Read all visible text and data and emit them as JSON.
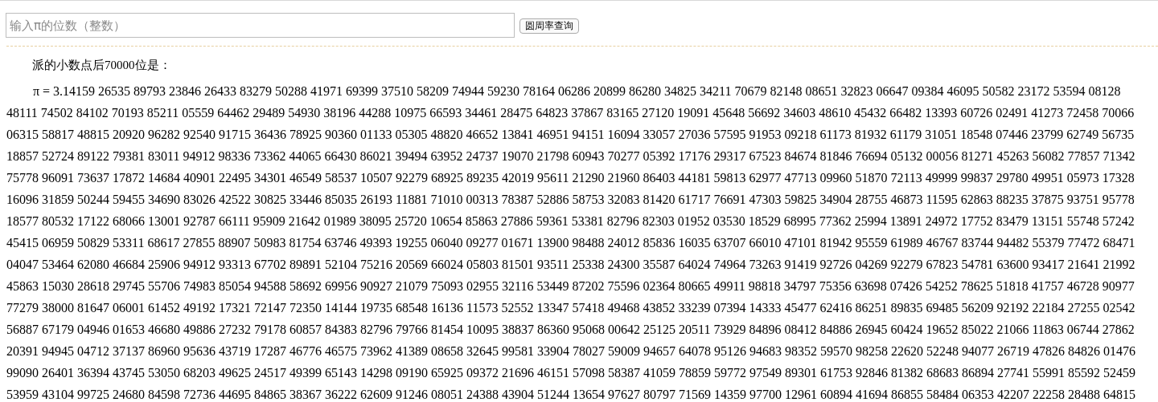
{
  "search": {
    "placeholder": "输入π的位数（整数）",
    "button": "圆周率查询"
  },
  "result": {
    "heading": "派的小数点后70000位是：",
    "lines": [
      "π = 3.14159 26535 89793 23846 26433 83279 50288 41971 69399 37510 58209 74944 59230 78164 06286 20899 86280 34825 34211 70679 82148 08651 32823 06647 09384 46095 50582 23172 53594 08128",
      "48111 74502 84102 70193 85211 05559 64462 29489 54930 38196 44288 10975 66593 34461 28475 64823 37867 83165 27120 19091 45648 56692 34603 48610 45432 66482 13393 60726 02491 41273 72458 70066",
      "06315 58817 48815 20920 96282 92540 91715 36436 78925 90360 01133 05305 48820 46652 13841 46951 94151 16094 33057 27036 57595 91953 09218 61173 81932 61179 31051 18548 07446 23799 62749 56735",
      "18857 52724 89122 79381 83011 94912 98336 73362 44065 66430 86021 39494 63952 24737 19070 21798 60943 70277 05392 17176 29317 67523 84674 81846 76694 05132 00056 81271 45263 56082 77857 71342",
      "75778 96091 73637 17872 14684 40901 22495 34301 46549 58537 10507 92279 68925 89235 42019 95611 21290 21960 86403 44181 59813 62977 47713 09960 51870 72113 49999 99837 29780 49951 05973 17328",
      "16096 31859 50244 59455 34690 83026 42522 30825 33446 85035 26193 11881 71010 00313 78387 52886 58753 32083 81420 61717 76691 47303 59825 34904 28755 46873 11595 62863 88235 37875 93751 95778",
      "18577 80532 17122 68066 13001 92787 66111 95909 21642 01989 38095 25720 10654 85863 27886 59361 53381 82796 82303 01952 03530 18529 68995 77362 25994 13891 24972 17752 83479 13151 55748 57242",
      "45415 06959 50829 53311 68617 27855 88907 50983 81754 63746 49393 19255 06040 09277 01671 13900 98488 24012 85836 16035 63707 66010 47101 81942 95559 61989 46767 83744 94482 55379 77472 68471",
      "04047 53464 62080 46684 25906 94912 93313 67702 89891 52104 75216 20569 66024 05803 81501 93511 25338 24300 35587 64024 74964 73263 91419 92726 04269 92279 67823 54781 63600 93417 21641 21992",
      "45863 15030 28618 29745 55706 74983 85054 94588 58692 69956 90927 21079 75093 02955 32116 53449 87202 75596 02364 80665 49911 98818 34797 75356 63698 07426 54252 78625 51818 41757 46728 90977",
      "77279 38000 81647 06001 61452 49192 17321 72147 72350 14144 19735 68548 16136 11573 52552 13347 57418 49468 43852 33239 07394 14333 45477 62416 86251 89835 69485 56209 92192 22184 27255 02542",
      "56887 67179 04946 01653 46680 49886 27232 79178 60857 84383 82796 79766 81454 10095 38837 86360 95068 00642 25125 20511 73929 84896 08412 84886 26945 60424 19652 85022 21066 11863 06744 27862",
      "20391 94945 04712 37137 86960 95636 43719 17287 46776 46575 73962 41389 08658 32645 99581 33904 78027 59009 94657 64078 95126 94683 98352 59570 98258 22620 52248 94077 26719 47826 84826 01476",
      "99090 26401 36394 43745 53050 68203 49625 24517 49399 65143 14298 09190 65925 09372 21696 46151 57098 58387 41059 78859 59772 97549 89301 61753 92846 81382 68683 86894 27741 55991 85592 52459",
      "53959 43104 99725 24680 84598 72736 44695 84865 38367 36222 62609 91246 08051 24388 43904 51244 13654 97627 80797 71569 14359 97700 12961 60894 41694 86855 58484 06353 42207 22258 28488 64815"
    ]
  }
}
